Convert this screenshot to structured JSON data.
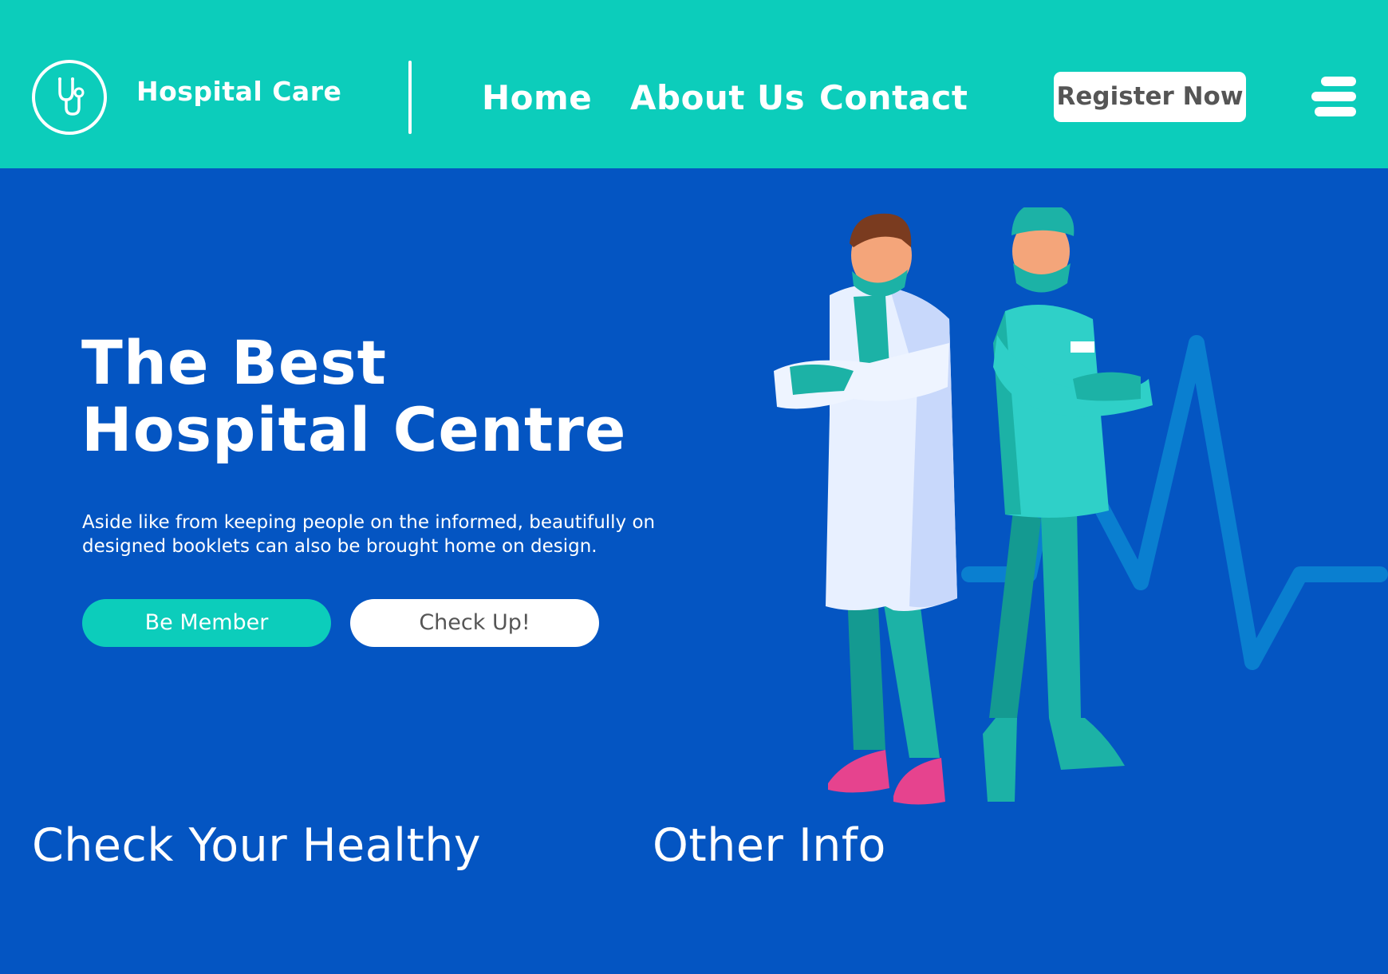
{
  "header": {
    "brand": "Hospital Care",
    "logo_icon": "stethoscope-icon",
    "nav": [
      {
        "label": "Home"
      },
      {
        "label": "About Us"
      },
      {
        "label": "Contact"
      }
    ],
    "register_label": "Register Now",
    "menu_icon": "hamburger-menu-icon"
  },
  "hero": {
    "title_line1": "The Best",
    "title_line2": "Hospital Centre",
    "description": "Aside like from keeping people on the informed, beautifully on designed booklets can also be brought home on design.",
    "primary_button": "Be Member",
    "secondary_button": "Check Up!"
  },
  "sections": {
    "left_title": "Check Your Healthy",
    "right_title": "Other Info"
  },
  "colors": {
    "background": "#0455c2",
    "header": "#0ccdbb",
    "accent": "#0ccdbb",
    "heartbeat_line": "#0a7fd0"
  }
}
